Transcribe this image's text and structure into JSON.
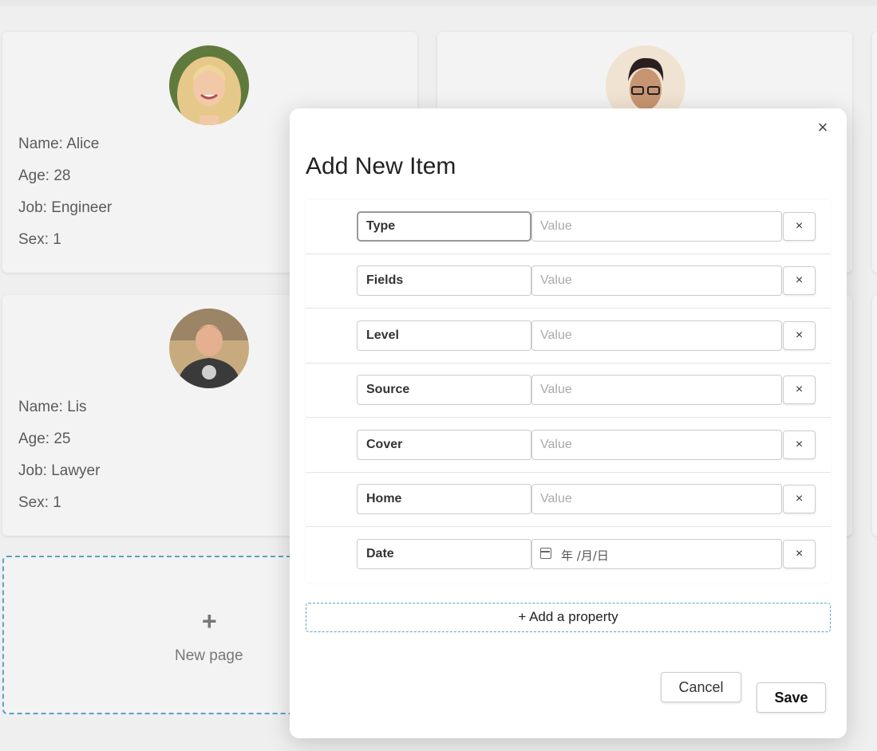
{
  "cards": [
    {
      "name": "Name: Alice",
      "age": "Age: 28",
      "job": "Job: Engineer",
      "sex": "Sex: 1",
      "avatar": "avatar-blonde-woman"
    },
    {
      "name": "Name: Lis",
      "age": "Age: 25",
      "job": "Job: Lawyer",
      "sex": "Sex: 1",
      "avatar": "avatar-man-tshirt"
    },
    {
      "avatar": "avatar-man-glasses"
    }
  ],
  "new_page": {
    "icon": "+",
    "label": "New page"
  },
  "modal": {
    "title": "Add New Item",
    "close_icon": "×",
    "value_placeholder": "Value",
    "properties": [
      {
        "key": "Type"
      },
      {
        "key": "Fields"
      },
      {
        "key": "Level"
      },
      {
        "key": "Source"
      },
      {
        "key": "Cover"
      },
      {
        "key": "Home"
      },
      {
        "key": "Date",
        "date_placeholder": "年 /月/日"
      }
    ],
    "delete_label": "×",
    "add_property_label": "+ Add a property",
    "cancel_label": "Cancel",
    "save_label": "Save"
  }
}
